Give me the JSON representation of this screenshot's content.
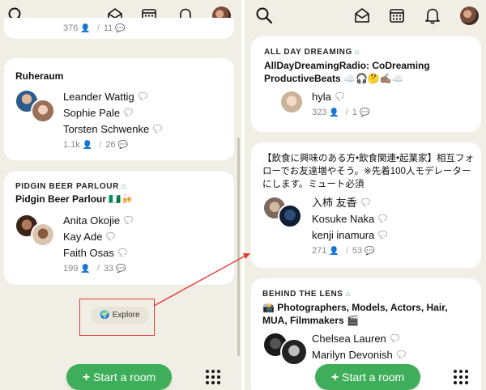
{
  "left": {
    "top_stats": {
      "people": "376",
      "chats": "11"
    },
    "room1": {
      "title": "Ruheraum",
      "names": [
        "Leander Wattig",
        "Sophie Pale",
        "Torsten Schwenke"
      ],
      "people": "1.1k",
      "chats": "26"
    },
    "room2": {
      "tag": "PIDGIN BEER PARLOUR",
      "title": "Pidgin Beer Parlour 🇳🇬🍻",
      "names": [
        "Anita Okojie",
        "Kay Ade",
        "Faith Osas"
      ],
      "people": "199",
      "chats": "33"
    },
    "explore_label": "Explore",
    "start_room_label": "Start a room"
  },
  "right": {
    "room1": {
      "tag": "ALL DAY DREAMING",
      "title": "AllDayDreamingRadio: CoDreaming ProductiveBeats ☁️🎧🤔✍🏽☁️",
      "names": [
        "hyla"
      ],
      "people": "323",
      "chats": "1"
    },
    "room2": {
      "title": "【飲食に興味のある方•飲食関連•起業家】相互フォローでお友達増やそう。※先着100人モデレーターにします。ミュート必須",
      "names": [
        "入柿 友香",
        "Kosuke Naka",
        "kenji inamura"
      ],
      "people": "271",
      "chats": "53"
    },
    "room3": {
      "tag": "BEHIND THE LENS",
      "title": "📸 Photographers, Models, Actors, Hair, MUA, Filmmakers 🎬",
      "names": [
        "Chelsea Lauren",
        "Marilyn Devonish"
      ]
    },
    "start_room_label": "Start a room"
  },
  "icons": {
    "search": "search-icon",
    "invite": "envelope-icon",
    "calendar": "calendar-icon",
    "notifications": "bell-icon",
    "house": "house-icon",
    "people": "person-icon",
    "chat": "chat-bubble-icon",
    "globe": "globe-icon",
    "grid": "grid-dots-icon"
  },
  "colors": {
    "background": "#f1efe5",
    "card": "#ffffff",
    "accent_green": "#3fae5a",
    "annotation_red": "#e53935"
  }
}
